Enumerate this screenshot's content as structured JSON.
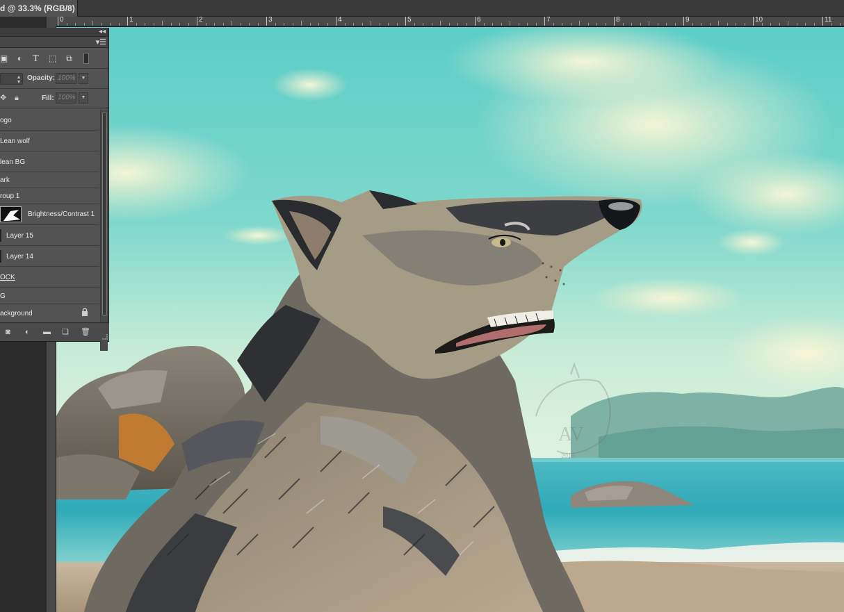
{
  "document": {
    "tab_title": "d @ 33.3% (RGB/8) *"
  },
  "ruler": {
    "labels": [
      "0",
      "1",
      "2",
      "3",
      "4",
      "5",
      "6",
      "7",
      "8",
      "9",
      "10",
      "11"
    ]
  },
  "layers_panel": {
    "opacity_label": "Opacity:",
    "opacity_value": "100%",
    "fill_label": "Fill:",
    "fill_value": "100%",
    "layers": [
      {
        "name": "ogo"
      },
      {
        "name": "Lean wolf"
      },
      {
        "name": "lean BG"
      },
      {
        "name": "ark"
      },
      {
        "name": "roup 1"
      },
      {
        "name": "Brightness/Contrast 1"
      },
      {
        "name": "Layer 15"
      },
      {
        "name": "Layer 14"
      },
      {
        "name": "OCK"
      },
      {
        "name": "G"
      },
      {
        "name": "ackground"
      }
    ]
  },
  "artwork": {
    "watermark_year": "2015",
    "watermark_initials": "AV"
  },
  "colors": {
    "panel_bg": "#535353",
    "workspace_bg": "#2b2b2b",
    "sky_top": "#5fcfc6",
    "sea": "#3fb8c0"
  }
}
